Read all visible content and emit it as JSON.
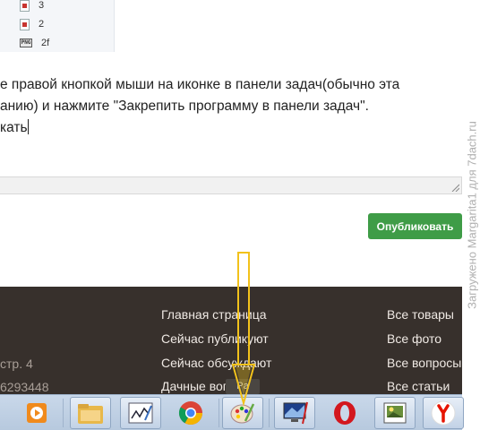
{
  "file_list": [
    {
      "type": "pdf",
      "name": "3"
    },
    {
      "type": "pdf",
      "name": "2"
    },
    {
      "type": "png",
      "name": "2f",
      "badge": "PNG"
    }
  ],
  "editor": {
    "lines": [
      "е правой кнопкой мыши на иконке в панели задач(обычно эта",
      "анию)  и нажмите \"Закрепить программу в панели задач\".",
      "кать"
    ]
  },
  "publish_button": "Опубликовать",
  "footer": {
    "left": [
      "стр. 4",
      "6293448"
    ],
    "middle": [
      "Главная страница",
      "Сейчас публикуют",
      "Сейчас обсуждают",
      "Дачные вопросы"
    ],
    "right": [
      "Все товары",
      "Все фото",
      "Все вопросы",
      "Все статьи"
    ]
  },
  "taskbar": {
    "tooltip": "Pa",
    "icons": [
      "media-player-icon",
      "file-explorer-icon",
      "signature-app-icon",
      "chrome-icon",
      "paint-icon",
      "display-settings-icon",
      "opera-icon",
      "image-viewer-icon",
      "yandex-browser-icon"
    ]
  },
  "watermark": "Загружено Margarita1 для 7dach.ru",
  "colors": {
    "publish": "#3f9c47",
    "footer_bg": "#37302c",
    "arrow": "#f2c21b",
    "taskbar": "#c9d8ea"
  }
}
